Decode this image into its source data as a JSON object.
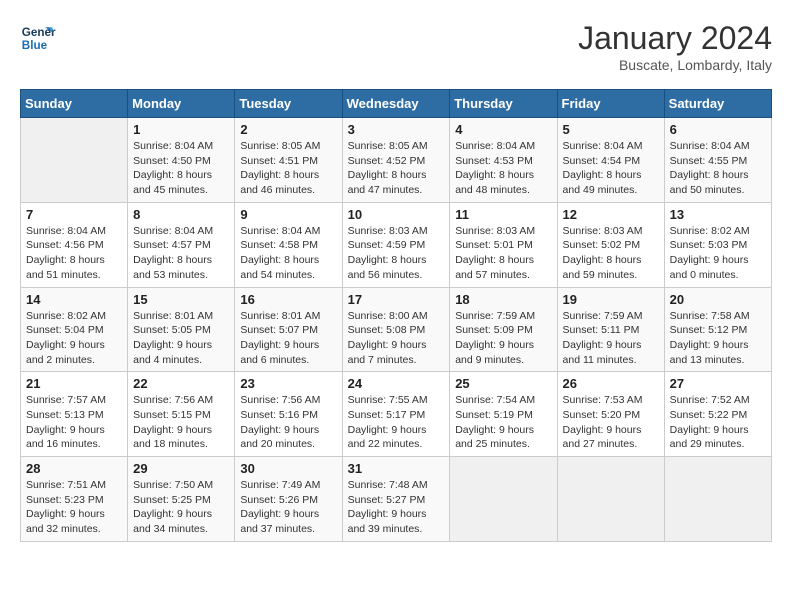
{
  "logo": {
    "line1": "General",
    "line2": "Blue"
  },
  "title": "January 2024",
  "subtitle": "Buscate, Lombardy, Italy",
  "weekdays": [
    "Sunday",
    "Monday",
    "Tuesday",
    "Wednesday",
    "Thursday",
    "Friday",
    "Saturday"
  ],
  "weeks": [
    [
      {
        "day": "",
        "info": ""
      },
      {
        "day": "1",
        "info": "Sunrise: 8:04 AM\nSunset: 4:50 PM\nDaylight: 8 hours\nand 45 minutes."
      },
      {
        "day": "2",
        "info": "Sunrise: 8:05 AM\nSunset: 4:51 PM\nDaylight: 8 hours\nand 46 minutes."
      },
      {
        "day": "3",
        "info": "Sunrise: 8:05 AM\nSunset: 4:52 PM\nDaylight: 8 hours\nand 47 minutes."
      },
      {
        "day": "4",
        "info": "Sunrise: 8:04 AM\nSunset: 4:53 PM\nDaylight: 8 hours\nand 48 minutes."
      },
      {
        "day": "5",
        "info": "Sunrise: 8:04 AM\nSunset: 4:54 PM\nDaylight: 8 hours\nand 49 minutes."
      },
      {
        "day": "6",
        "info": "Sunrise: 8:04 AM\nSunset: 4:55 PM\nDaylight: 8 hours\nand 50 minutes."
      }
    ],
    [
      {
        "day": "7",
        "info": "Sunrise: 8:04 AM\nSunset: 4:56 PM\nDaylight: 8 hours\nand 51 minutes."
      },
      {
        "day": "8",
        "info": "Sunrise: 8:04 AM\nSunset: 4:57 PM\nDaylight: 8 hours\nand 53 minutes."
      },
      {
        "day": "9",
        "info": "Sunrise: 8:04 AM\nSunset: 4:58 PM\nDaylight: 8 hours\nand 54 minutes."
      },
      {
        "day": "10",
        "info": "Sunrise: 8:03 AM\nSunset: 4:59 PM\nDaylight: 8 hours\nand 56 minutes."
      },
      {
        "day": "11",
        "info": "Sunrise: 8:03 AM\nSunset: 5:01 PM\nDaylight: 8 hours\nand 57 minutes."
      },
      {
        "day": "12",
        "info": "Sunrise: 8:03 AM\nSunset: 5:02 PM\nDaylight: 8 hours\nand 59 minutes."
      },
      {
        "day": "13",
        "info": "Sunrise: 8:02 AM\nSunset: 5:03 PM\nDaylight: 9 hours\nand 0 minutes."
      }
    ],
    [
      {
        "day": "14",
        "info": "Sunrise: 8:02 AM\nSunset: 5:04 PM\nDaylight: 9 hours\nand 2 minutes."
      },
      {
        "day": "15",
        "info": "Sunrise: 8:01 AM\nSunset: 5:05 PM\nDaylight: 9 hours\nand 4 minutes."
      },
      {
        "day": "16",
        "info": "Sunrise: 8:01 AM\nSunset: 5:07 PM\nDaylight: 9 hours\nand 6 minutes."
      },
      {
        "day": "17",
        "info": "Sunrise: 8:00 AM\nSunset: 5:08 PM\nDaylight: 9 hours\nand 7 minutes."
      },
      {
        "day": "18",
        "info": "Sunrise: 7:59 AM\nSunset: 5:09 PM\nDaylight: 9 hours\nand 9 minutes."
      },
      {
        "day": "19",
        "info": "Sunrise: 7:59 AM\nSunset: 5:11 PM\nDaylight: 9 hours\nand 11 minutes."
      },
      {
        "day": "20",
        "info": "Sunrise: 7:58 AM\nSunset: 5:12 PM\nDaylight: 9 hours\nand 13 minutes."
      }
    ],
    [
      {
        "day": "21",
        "info": "Sunrise: 7:57 AM\nSunset: 5:13 PM\nDaylight: 9 hours\nand 16 minutes."
      },
      {
        "day": "22",
        "info": "Sunrise: 7:56 AM\nSunset: 5:15 PM\nDaylight: 9 hours\nand 18 minutes."
      },
      {
        "day": "23",
        "info": "Sunrise: 7:56 AM\nSunset: 5:16 PM\nDaylight: 9 hours\nand 20 minutes."
      },
      {
        "day": "24",
        "info": "Sunrise: 7:55 AM\nSunset: 5:17 PM\nDaylight: 9 hours\nand 22 minutes."
      },
      {
        "day": "25",
        "info": "Sunrise: 7:54 AM\nSunset: 5:19 PM\nDaylight: 9 hours\nand 25 minutes."
      },
      {
        "day": "26",
        "info": "Sunrise: 7:53 AM\nSunset: 5:20 PM\nDaylight: 9 hours\nand 27 minutes."
      },
      {
        "day": "27",
        "info": "Sunrise: 7:52 AM\nSunset: 5:22 PM\nDaylight: 9 hours\nand 29 minutes."
      }
    ],
    [
      {
        "day": "28",
        "info": "Sunrise: 7:51 AM\nSunset: 5:23 PM\nDaylight: 9 hours\nand 32 minutes."
      },
      {
        "day": "29",
        "info": "Sunrise: 7:50 AM\nSunset: 5:25 PM\nDaylight: 9 hours\nand 34 minutes."
      },
      {
        "day": "30",
        "info": "Sunrise: 7:49 AM\nSunset: 5:26 PM\nDaylight: 9 hours\nand 37 minutes."
      },
      {
        "day": "31",
        "info": "Sunrise: 7:48 AM\nSunset: 5:27 PM\nDaylight: 9 hours\nand 39 minutes."
      },
      {
        "day": "",
        "info": ""
      },
      {
        "day": "",
        "info": ""
      },
      {
        "day": "",
        "info": ""
      }
    ]
  ]
}
